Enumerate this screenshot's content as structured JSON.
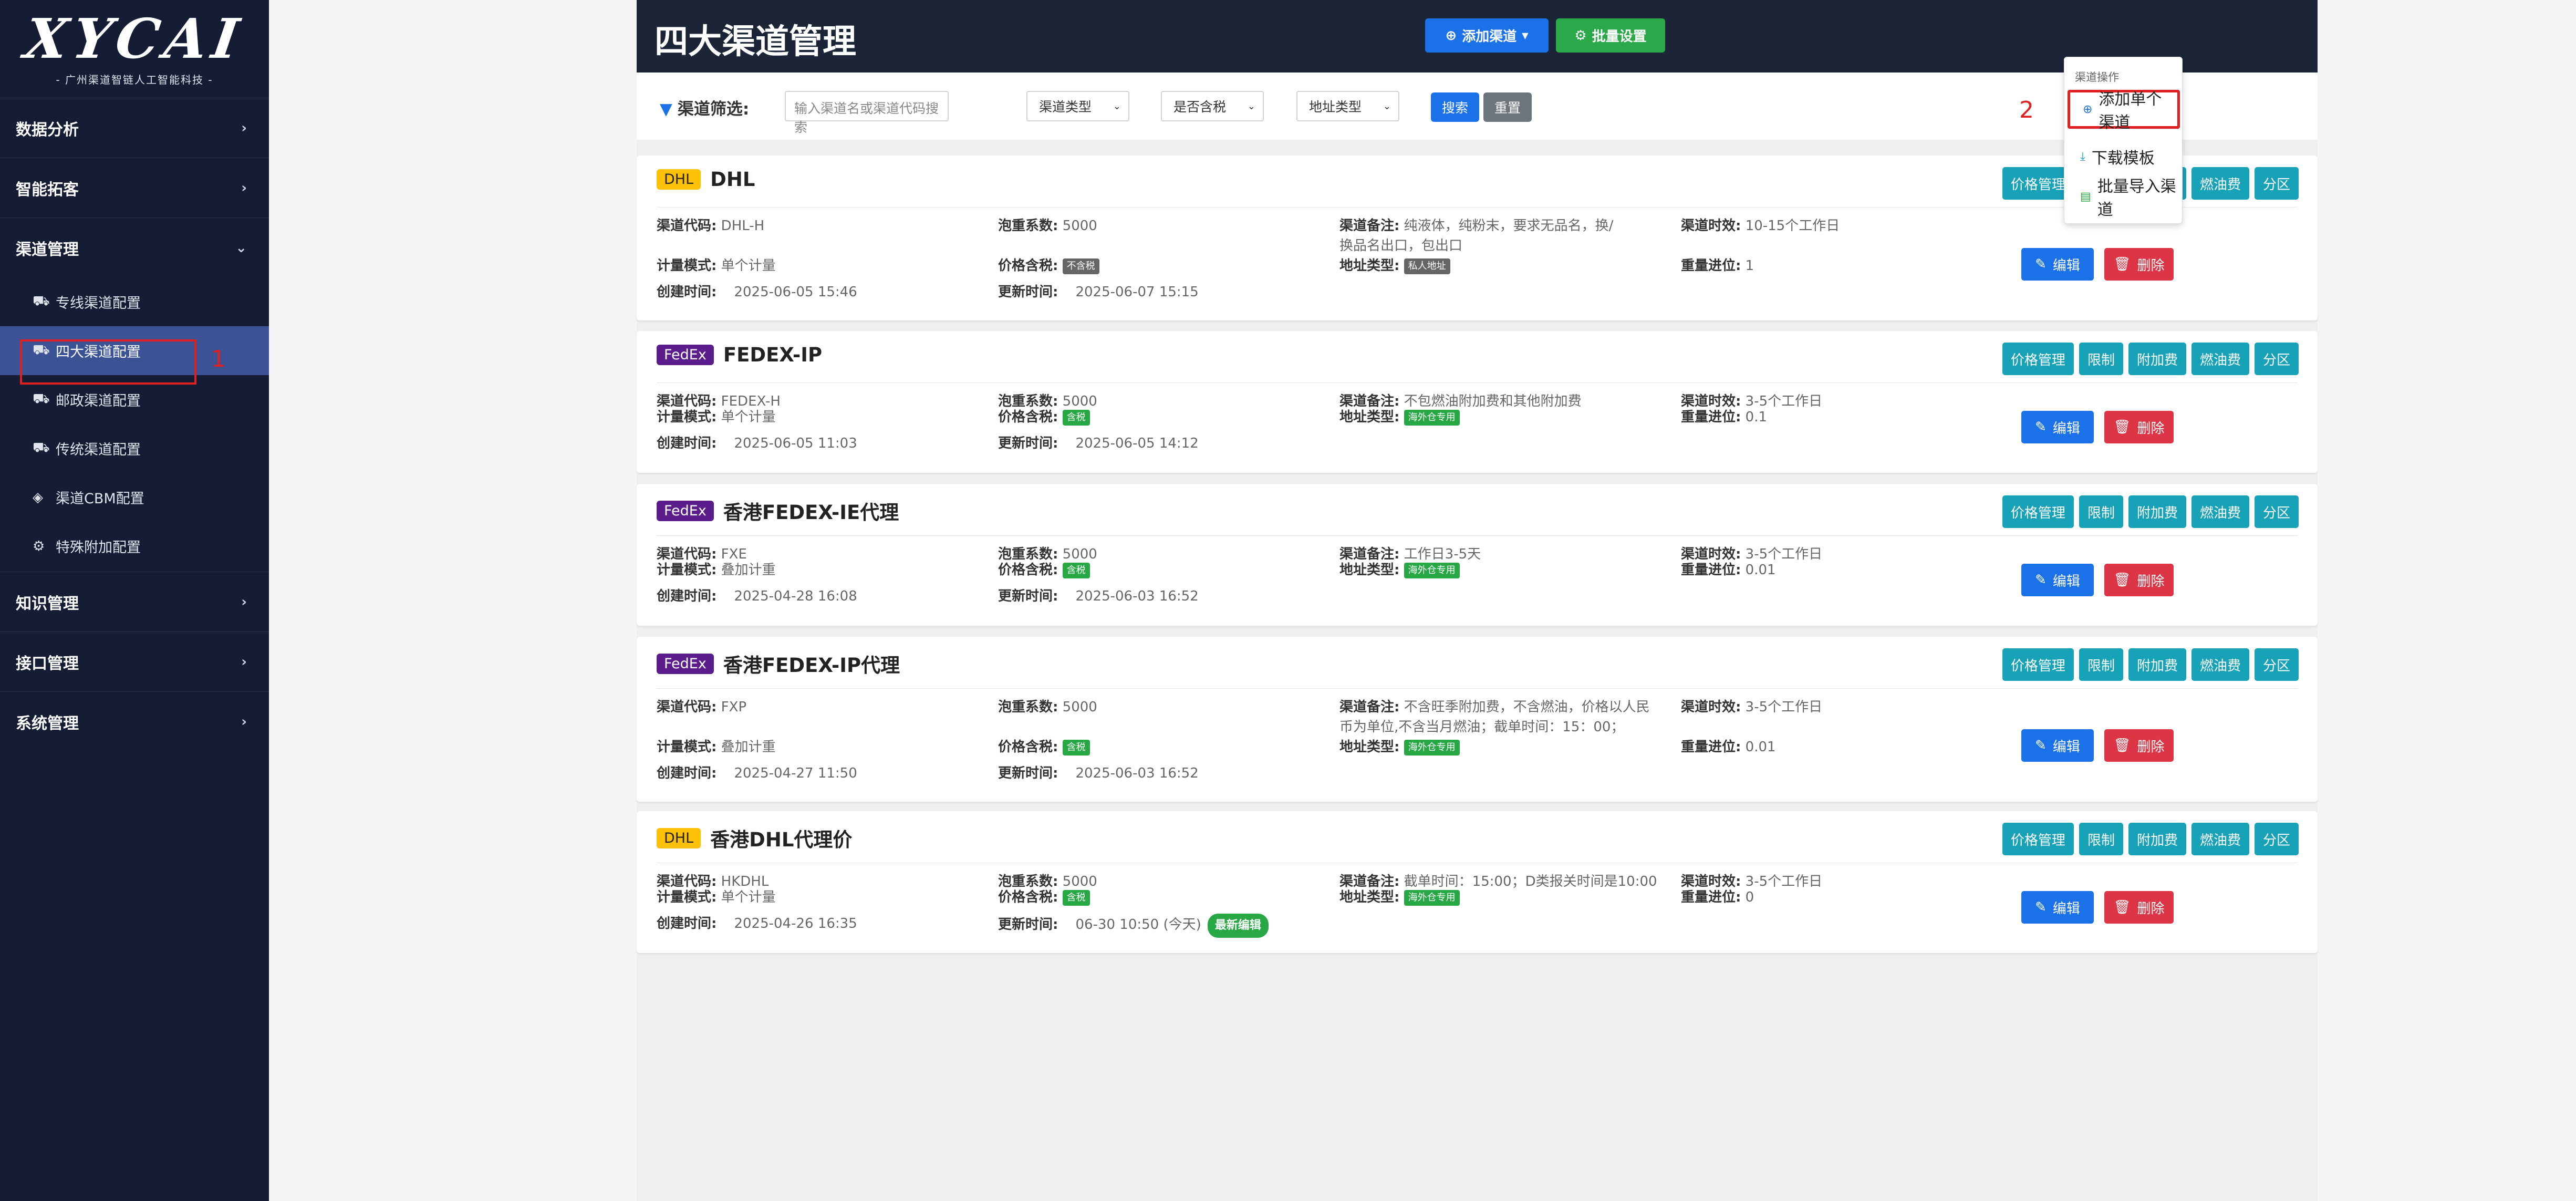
{
  "brand": {
    "logo": "XYCAI",
    "tagline": "- 广州渠道智链人工智能科技 -"
  },
  "sidebar": {
    "groups": [
      {
        "label": "数据分析",
        "chevron": "›"
      },
      {
        "label": "智能拓客",
        "chevron": "›"
      },
      {
        "label": "渠道管理",
        "chevron": "⌄"
      }
    ],
    "sub_items": [
      {
        "label": "专线渠道配置",
        "icon": "truck-icon"
      },
      {
        "label": "四大渠道配置",
        "icon": "truck-icon"
      },
      {
        "label": "邮政渠道配置",
        "icon": "truck-icon"
      },
      {
        "label": "传统渠道配置",
        "icon": "truck-icon"
      },
      {
        "label": "渠道CBM配置",
        "icon": "cube-icon"
      },
      {
        "label": "特殊附加配置",
        "icon": "gear-icon"
      }
    ],
    "groups_after": [
      {
        "label": "知识管理",
        "chevron": "›"
      },
      {
        "label": "接口管理",
        "chevron": "›"
      },
      {
        "label": "系统管理",
        "chevron": "›"
      }
    ]
  },
  "header": {
    "title": "四大渠道管理",
    "add_label": "添加渠道",
    "batch_label": "批量设置"
  },
  "filter": {
    "label": "渠道筛选:",
    "placeholder": "输入渠道名或渠道代码搜索",
    "selects": [
      "渠道类型",
      "是否含税",
      "地址类型"
    ],
    "search_label": "搜索",
    "reset_label": "重置"
  },
  "dropdown": {
    "header": "渠道操作",
    "items": [
      "添加单个渠道",
      "下载模板",
      "批量导入渠道"
    ]
  },
  "annotations": {
    "one": "1",
    "two": "2"
  },
  "card_labels": {
    "code": "渠道代码:",
    "bubble": "泡重系数:",
    "remark": "渠道备注:",
    "timeliness": "渠道时效:",
    "mode": "计量模式:",
    "tax": "价格含税:",
    "address": "地址类型:",
    "carry": "重量进位:",
    "created": "创建时间:",
    "updated": "更新时间:",
    "edit": "编辑",
    "delete": "删除",
    "actions": [
      "价格管理",
      "限制",
      "附加费",
      "燃油费",
      "分区"
    ],
    "latest_badge": "最新编辑"
  },
  "channels": [
    {
      "carrier": "DHL",
      "name": "DHL",
      "code": "DHL-H",
      "bubble": "5000",
      "remark_line1": "纯液体，纯粉末，要求无品名，换/",
      "remark_line2": "换品名出口，包出口",
      "timeliness": "10-15个工作日",
      "mode": "单个计量",
      "tax": "不含税",
      "address": "私人地址",
      "carry": "1",
      "created": "2025-06-05 15:46",
      "updated": "2025-06-07 15:15"
    },
    {
      "carrier": "FedEx",
      "name": "FEDEX-IP",
      "code": "FEDEX-H",
      "bubble": "5000",
      "remark_line1": "不包燃油附加费和其他附加费",
      "remark_line2": "",
      "timeliness": "3-5个工作日",
      "mode": "单个计量",
      "tax": "含税",
      "address": "海外仓专用",
      "carry": "0.1",
      "created": "2025-06-05 11:03",
      "updated": "2025-06-05 14:12"
    },
    {
      "carrier": "FedEx",
      "name": "香港FEDEX-IE代理",
      "code": "FXE",
      "bubble": "5000",
      "remark_line1": "工作日3-5天",
      "remark_line2": "",
      "timeliness": "3-5个工作日",
      "mode": "叠加计重",
      "tax": "含税",
      "address": "海外仓专用",
      "carry": "0.01",
      "created": "2025-04-28 16:08",
      "updated": "2025-06-03 16:52"
    },
    {
      "carrier": "FedEx",
      "name": "香港FEDEX-IP代理",
      "code": "FXP",
      "bubble": "5000",
      "remark_line1": "不含旺季附加费，不含燃油，价格以人民",
      "remark_line2": "币为单位,不含当月燃油；截单时间：15：00；",
      "timeliness": "3-5个工作日",
      "mode": "叠加计重",
      "tax": "含税",
      "address": "海外仓专用",
      "carry": "0.01",
      "created": "2025-04-27 11:50",
      "updated": "2025-06-03 16:52"
    },
    {
      "carrier": "DHL",
      "name": "香港DHL代理价",
      "code": "HKDHL",
      "bubble": "5000",
      "remark_line1": "截单时间：15:00；D类报关时间是10:00",
      "remark_line2": "",
      "timeliness": "3-5个工作日",
      "mode": "单个计量",
      "tax": "含税",
      "address": "海外仓专用",
      "carry": "0",
      "created": "2025-04-26 16:35",
      "updated": "06-30 10:50 (今天)"
    }
  ],
  "colors": {
    "sidebar": "#141d33",
    "active": "#3b5394",
    "primary": "#1b72e8",
    "success": "#2ba84a",
    "info": "#17a2b8",
    "danger": "#dc3545",
    "annotation": "#e02020"
  }
}
